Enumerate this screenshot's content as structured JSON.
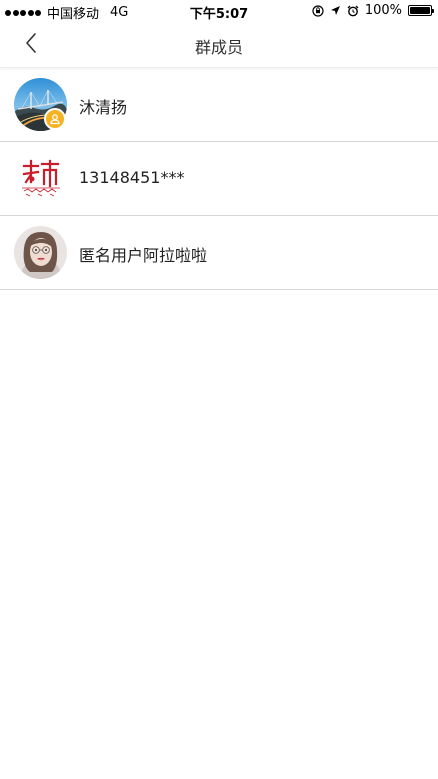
{
  "status_bar": {
    "carrier": "中国移动",
    "network": "4G",
    "time": "下午5:07",
    "battery": "100%",
    "battery_level": 1.0
  },
  "nav": {
    "title": "群成员",
    "back_icon": "chevron-left-icon"
  },
  "members": [
    {
      "name": "沐清扬",
      "avatar": "bridge-landscape-photo",
      "is_owner": true
    },
    {
      "name": "13148451***",
      "avatar": "red-calligraphy-logo",
      "is_owner": false
    },
    {
      "name": "匿名用户阿拉啦啦",
      "avatar": "woman-portrait-photo",
      "is_owner": false
    }
  ],
  "colors": {
    "owner_badge": "#f5b324",
    "divider": "#d8d8d8"
  }
}
